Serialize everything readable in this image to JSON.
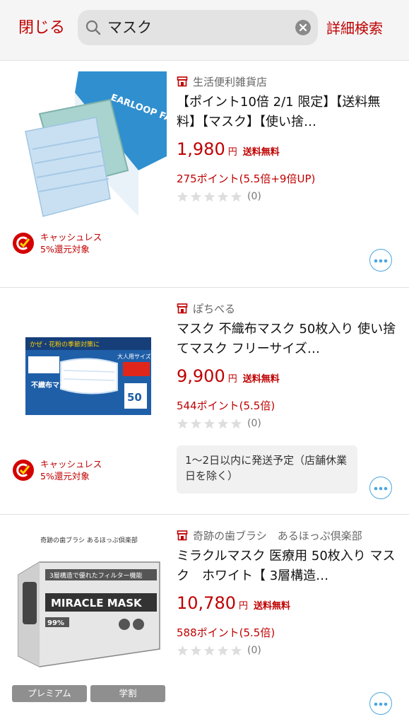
{
  "header": {
    "close_label": "閉じる",
    "search_query": "マスク",
    "advanced_search_label": "詳細検索"
  },
  "items": [
    {
      "shop": "生活便利雑貨店",
      "title": "【ポイント10倍 2/1 限定】【送料無料】【マスク】【使い捨…",
      "price": "1,980",
      "yen": "円",
      "shipping": "送料無料",
      "points": "275ポイント",
      "points_detail": "(5.5倍+9倍UP)",
      "reviews": "(0)",
      "rating": 0,
      "cashless_line1": "キャッシュレス",
      "cashless_line2": "5%還元対象",
      "image_text": "EARLOOP FACE MASK"
    },
    {
      "shop": "ぽちべる",
      "title": "マスク 不織布マスク 50枚入り 使い捨てマスク フリーサイズ…",
      "price": "9,900",
      "yen": "円",
      "shipping": "送料無料",
      "points": "544ポイント",
      "points_detail": "(5.5倍)",
      "reviews": "(0)",
      "rating": 0,
      "cashless_line1": "キャッシュレス",
      "cashless_line2": "5%還元対象",
      "shipping_note": "1〜2日以内に発送予定（店舗休業日を除く）",
      "image_text_top": "かぜ・花粉の季節対策に",
      "image_text_main": "不織布マスク",
      "image_text_count": "50",
      "image_text_size": "大人用サイズ"
    },
    {
      "shop": "奇跡の歯ブラシ　あるほっぷ倶楽部",
      "title": "ミラクルマスク 医療用 50枚入り マスク　ホワイト【 3層構造…",
      "price": "10,780",
      "yen": "円",
      "shipping": "送料無料",
      "points": "588ポイント",
      "points_detail": "(5.5倍)",
      "reviews": "(0)",
      "rating": 0,
      "badges": [
        "プレミアム",
        "学割"
      ],
      "image_caption": "奇跡の歯ブラシ あるほっぷ倶楽部",
      "image_text_band": "3層構造で優れたフィルター機能",
      "image_text_main": "MIRACLE MASK",
      "image_text_pct": "99%"
    }
  ],
  "colors": {
    "accent": "#bf0000",
    "more_button": "#4aa6e0"
  }
}
